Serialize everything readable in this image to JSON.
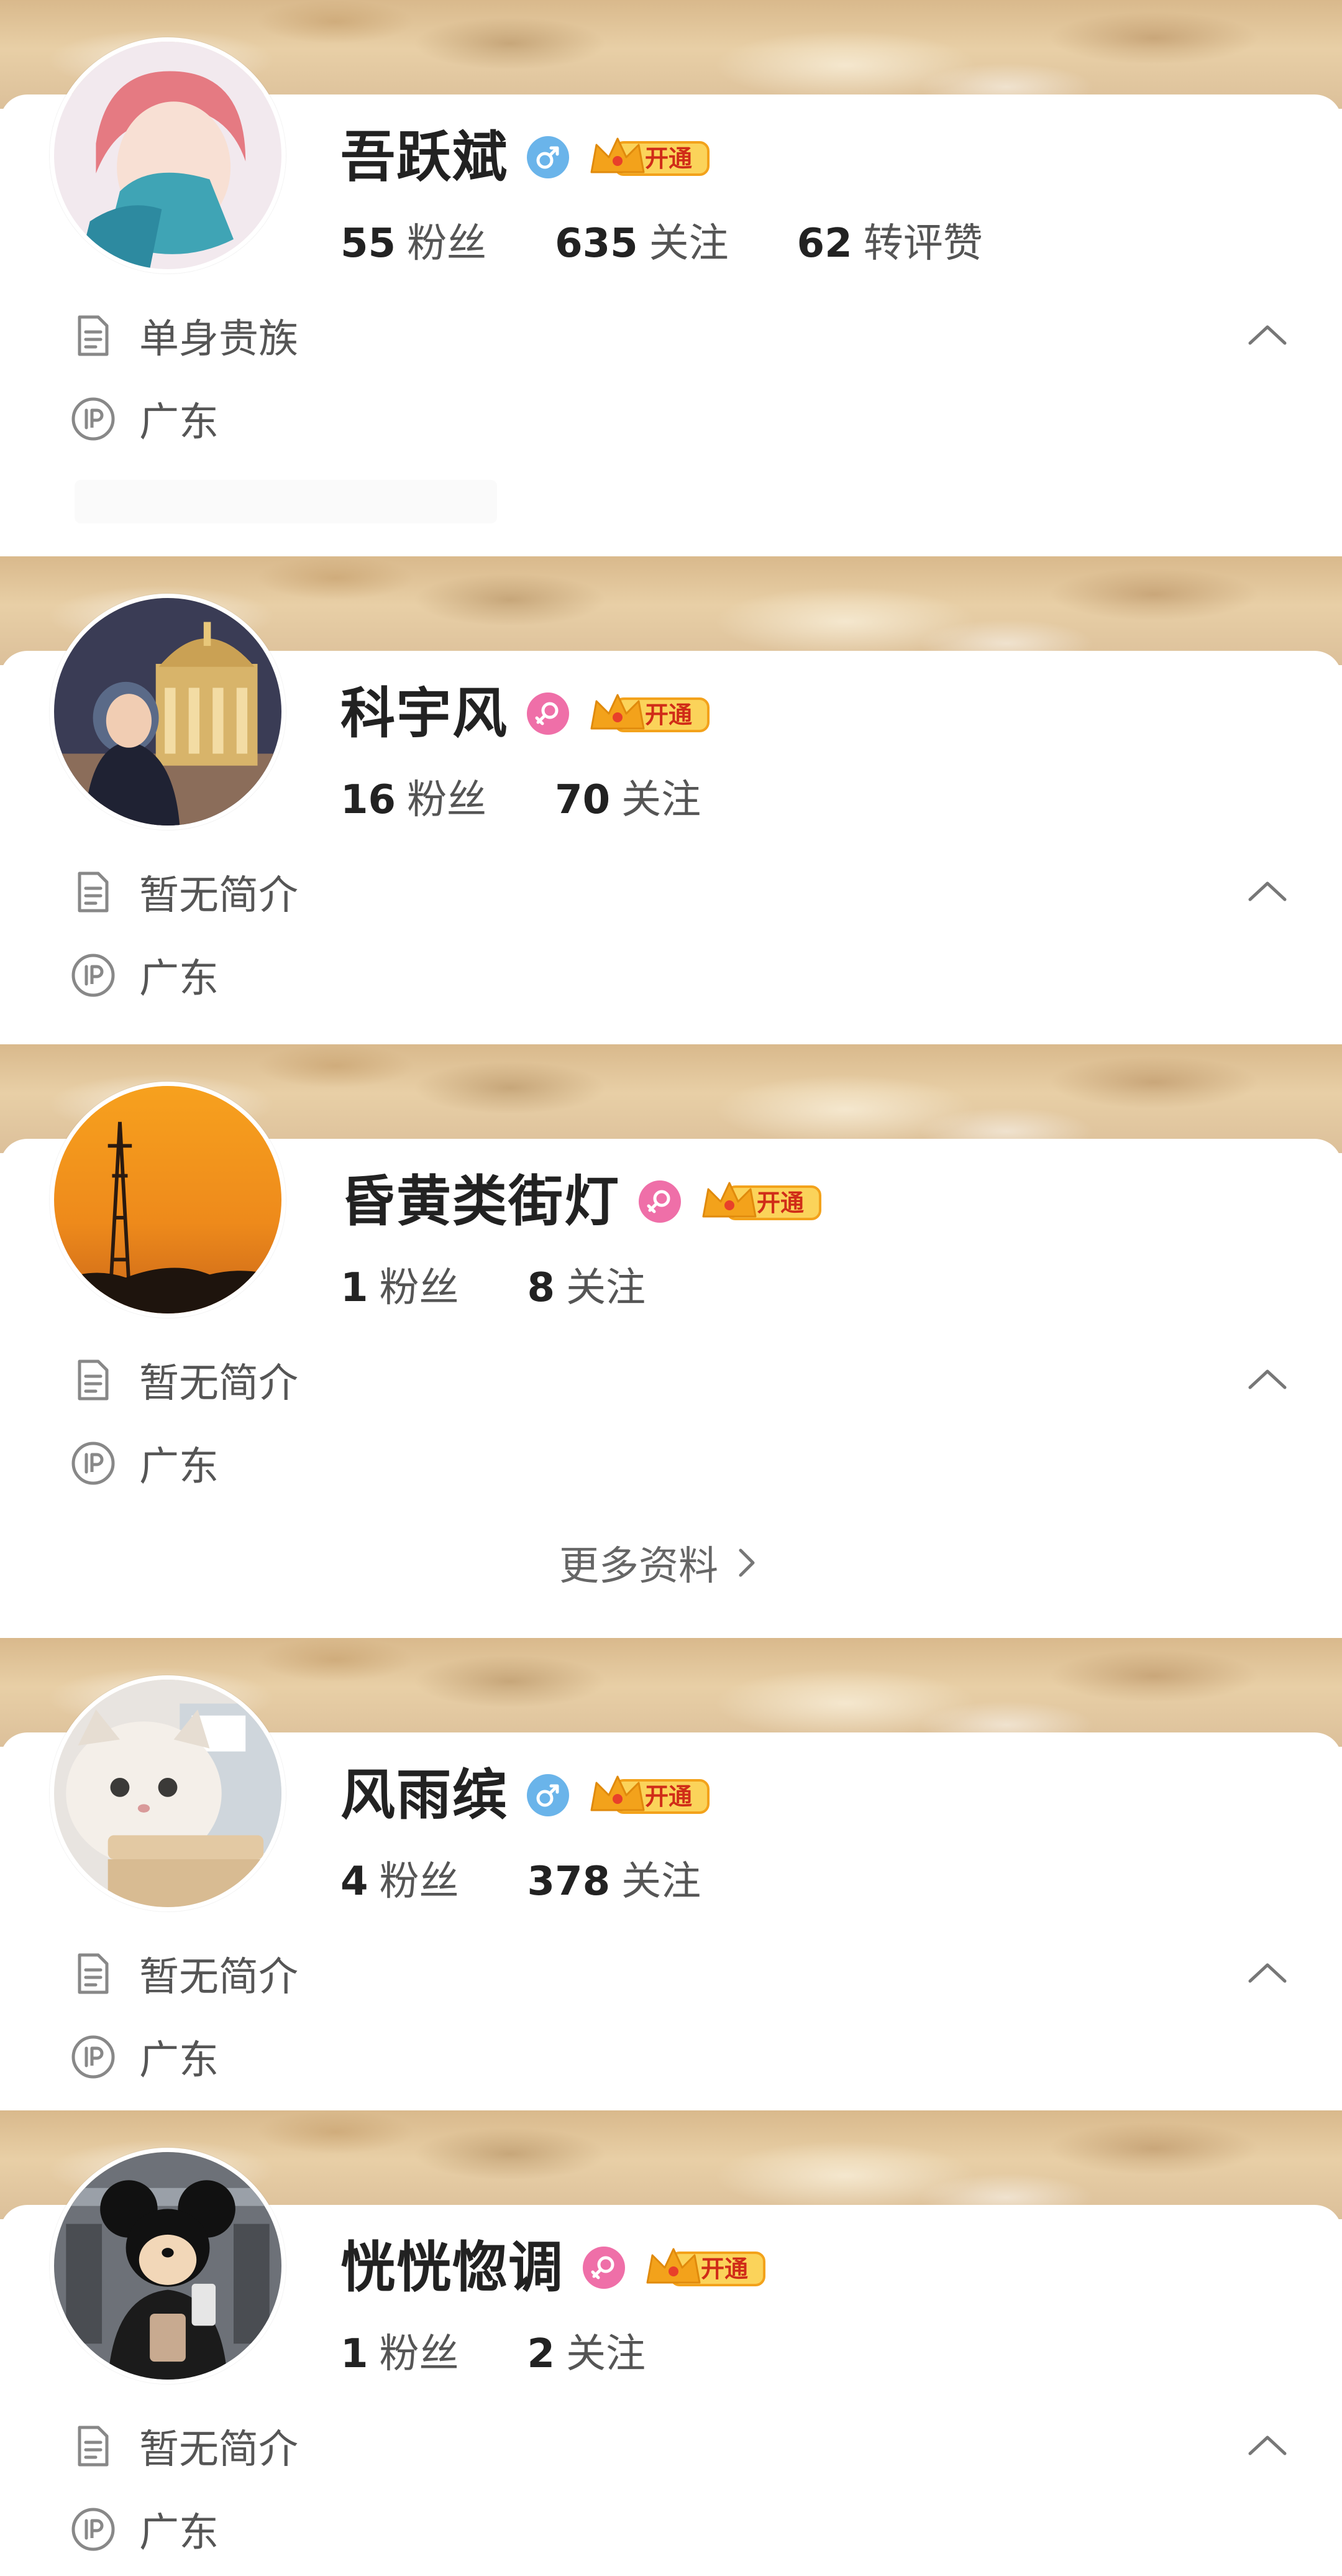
{
  "colors": {
    "male": "#6ab4ea",
    "female": "#ef6fa8",
    "vip_gold": "#f3a21b",
    "vip_text": "#d02c18",
    "text_primary": "#222222",
    "text_secondary": "#555555"
  },
  "profiles": [
    {
      "name": "吾跃斌",
      "gender": "male",
      "gender_icon": "male-icon",
      "vip_label": "开通",
      "followers": "55",
      "followers_label": "粉丝",
      "following": "635",
      "following_label": "关注",
      "interactions": "62",
      "interactions_label": "转评赞",
      "bio": "单身贵族",
      "ip": "广东"
    },
    {
      "name": "科宇风",
      "gender": "female",
      "gender_icon": "female-icon",
      "vip_label": "开通",
      "followers": "16",
      "followers_label": "粉丝",
      "following": "70",
      "following_label": "关注",
      "bio": "暂无简介",
      "ip": "广东"
    },
    {
      "name": "昏黄类街灯",
      "gender": "female",
      "gender_icon": "female-icon",
      "vip_label": "开通",
      "followers": "1",
      "followers_label": "粉丝",
      "following": "8",
      "following_label": "关注",
      "bio": "暂无简介",
      "ip": "广东",
      "more_label": "更多资料"
    },
    {
      "name": "风雨缤",
      "gender": "male",
      "gender_icon": "male-icon",
      "vip_label": "开通",
      "followers": "4",
      "followers_label": "粉丝",
      "following": "378",
      "following_label": "关注",
      "bio": "暂无简介",
      "ip": "广东"
    },
    {
      "name": "恍恍惚调",
      "gender": "female",
      "gender_icon": "female-icon",
      "vip_label": "开通",
      "followers": "1",
      "followers_label": "粉丝",
      "following": "2",
      "following_label": "关注",
      "bio": "暂无简介",
      "ip": "广东"
    }
  ]
}
